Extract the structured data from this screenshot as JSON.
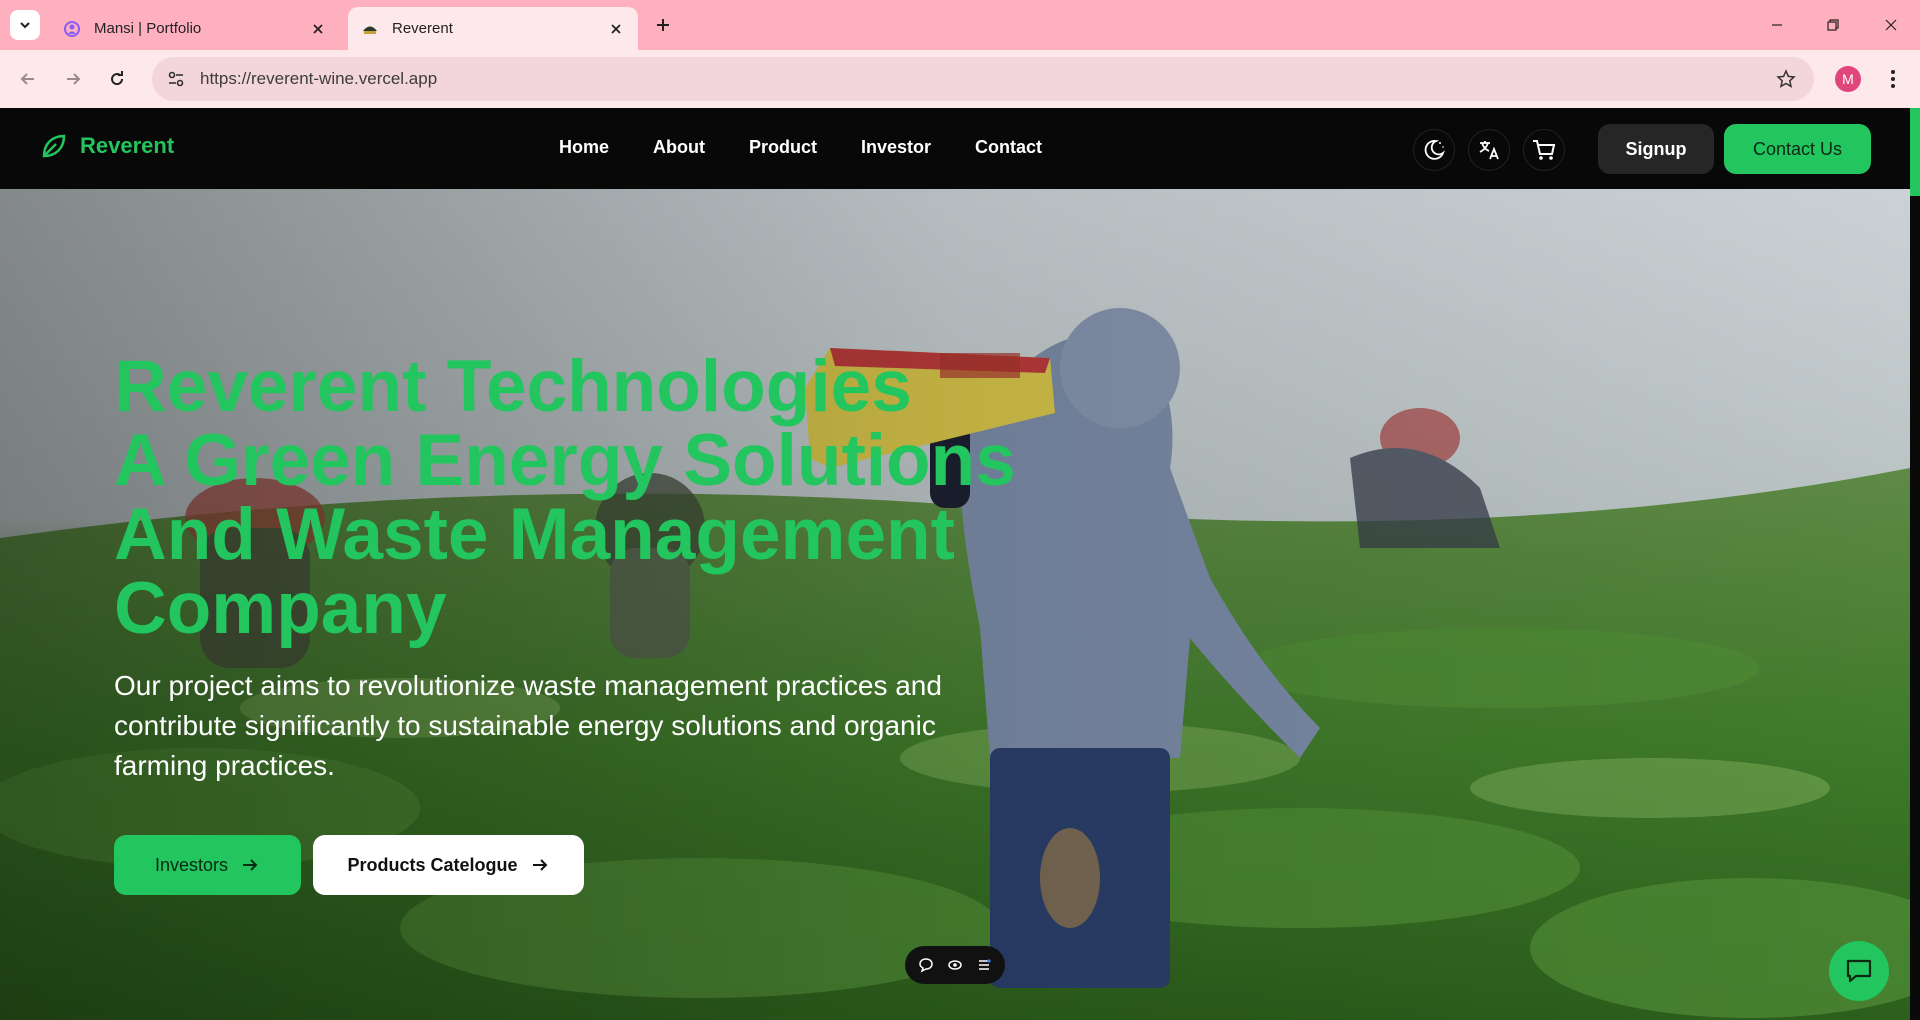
{
  "browser": {
    "tabs": [
      {
        "title": "Mansi | Portfolio",
        "active": false,
        "favicon": "portfolio-favicon-icon"
      },
      {
        "title": "Reverent",
        "active": true,
        "favicon": "reverent-favicon-icon"
      }
    ],
    "url": "https://reverent-wine.vercel.app",
    "profile_initial": "M",
    "theme_color": "#ffb0bf"
  },
  "site": {
    "brand": "Reverent",
    "nav": [
      "Home",
      "About",
      "Product",
      "Investor",
      "Contact"
    ],
    "icons": [
      "theme-toggle-icon",
      "translate-icon",
      "cart-icon"
    ],
    "signup_label": "Signup",
    "contact_label": "Contact Us",
    "accent_color": "#22c55e"
  },
  "hero": {
    "title_lines": [
      "Reverent Technologies",
      "A Green Energy Solutions",
      "And Waste Management",
      "Company"
    ],
    "subtitle": "Our project aims to revolutionize waste management practices and contribute significantly to sustainable energy solutions and organic farming practices.",
    "buttons": {
      "investors": "Investors",
      "catalogue": "Products Catelogue"
    }
  },
  "floating": {
    "pill_icons": [
      "comment-icon",
      "eye-icon",
      "list-icon"
    ],
    "chat_icon": "chat-bubble-icon"
  }
}
